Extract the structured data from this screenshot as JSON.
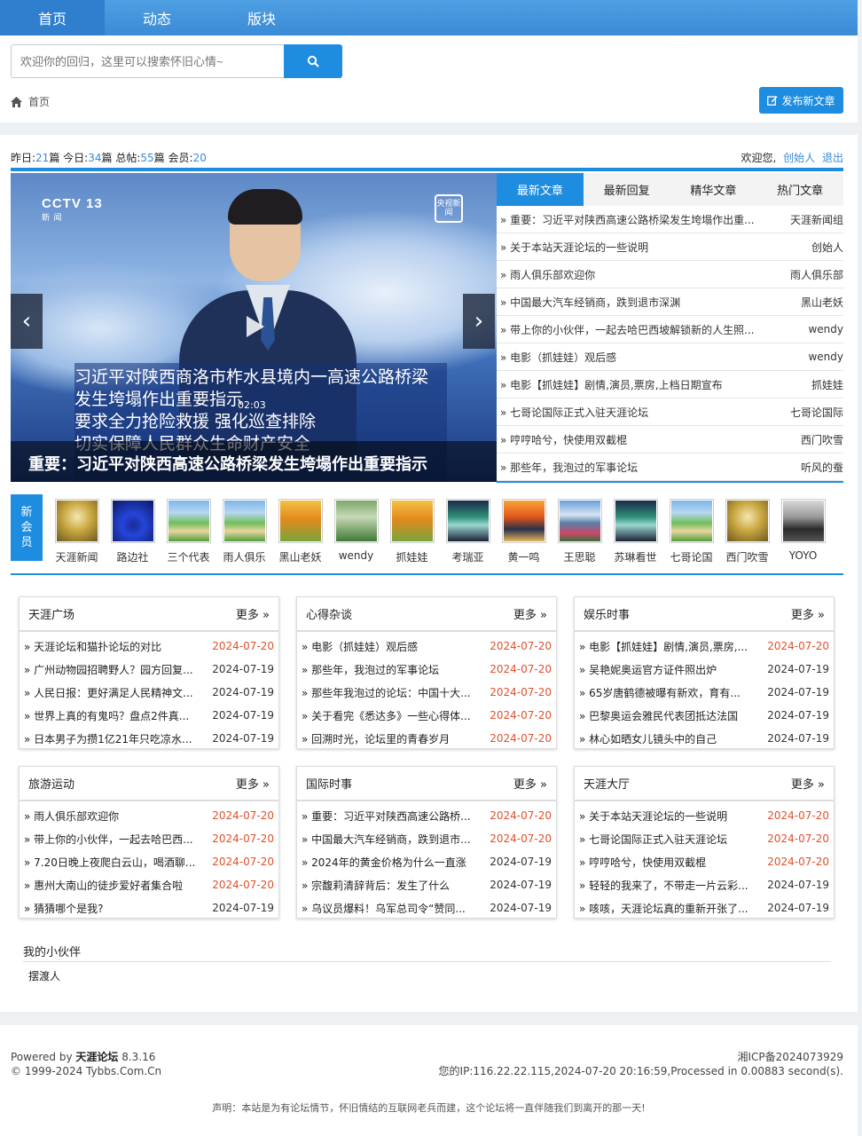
{
  "nav": {
    "items": [
      "首页",
      "动态",
      "版块"
    ]
  },
  "search": {
    "placeholder": "欢迎你的回归，这里可以搜索怀旧心情~"
  },
  "breadcrumb": {
    "home": "首页"
  },
  "publish_button": "发布新文章",
  "stats": {
    "yesterday_label": "昨日:",
    "yesterday": "21",
    "today_label": "今日:",
    "today": "34",
    "total_label": "总帖:",
    "total": "55",
    "members_label": "会员:",
    "members": "20",
    "unit": "篇"
  },
  "welcome": {
    "text": "欢迎您,",
    "user": "创始人",
    "logout": "退出"
  },
  "carousel": {
    "channel": "CCTV 13",
    "channel_sub": "新 闻",
    "badge": "央视新闻",
    "subtitle_lines": [
      "习近平对陕西商洛市柞水县境内一高速公路桥梁",
      "发生垮塌作出重要指示",
      "要求全力抢险救援 强化巡查排除",
      "切实保障人民群众生命财产安全"
    ],
    "timestamp": "02:03",
    "caption": "重要：习近平对陕西高速公路桥梁发生垮塌作出重要指示"
  },
  "tabs": [
    "最新文章",
    "最新回复",
    "精华文章",
    "热门文章"
  ],
  "articles": [
    {
      "title": "重要：习近平对陕西高速公路桥梁发生垮塌作出重...",
      "author": "天涯新闻组"
    },
    {
      "title": "关于本站天涯论坛的一些说明",
      "author": "创始人"
    },
    {
      "title": "雨人俱乐部欢迎你",
      "author": "雨人俱乐部"
    },
    {
      "title": "中国最大汽车经销商，跌到退市深渊",
      "author": "黑山老妖"
    },
    {
      "title": "带上你的小伙伴，一起去哈巴西坡解锁新的人生照...",
      "author": "wendy"
    },
    {
      "title": "电影（抓娃娃）观后感",
      "author": "wendy"
    },
    {
      "title": "电影【抓娃娃】剧情,演员,票房,上档日期宣布",
      "author": "抓娃娃"
    },
    {
      "title": "七哥论国际正式入驻天涯论坛",
      "author": "七哥论国际"
    },
    {
      "title": "哼哼哈兮，快使用双截棍",
      "author": "西门吹雪"
    },
    {
      "title": "那些年，我泡过的军事论坛",
      "author": "听风的蚕"
    }
  ],
  "members_label": [
    "新",
    "会",
    "员"
  ],
  "members": [
    {
      "name": "天涯新闻",
      "avatar": "flower-gold"
    },
    {
      "name": "路边社",
      "avatar": "blue-tree"
    },
    {
      "name": "三个代表",
      "avatar": "path-meadow"
    },
    {
      "name": "雨人俱乐",
      "avatar": "path-meadow"
    },
    {
      "name": "黑山老妖",
      "avatar": "autumn-tree"
    },
    {
      "name": "wendy",
      "avatar": "green-forest"
    },
    {
      "name": "抓娃娃",
      "avatar": "autumn-tree"
    },
    {
      "name": "考瑞亚",
      "avatar": "aurora"
    },
    {
      "name": "黄一鸣",
      "avatar": "cabin-sunset"
    },
    {
      "name": "王思聪",
      "avatar": "lake-mountain"
    },
    {
      "name": "苏琳看世",
      "avatar": "aurora"
    },
    {
      "name": "七哥论国",
      "avatar": "path-meadow"
    },
    {
      "name": "西门吹雪",
      "avatar": "flower-gold"
    },
    {
      "name": "YOYO",
      "avatar": "person-photo"
    }
  ],
  "more_label": "更多 »",
  "boxes": [
    {
      "title": "天涯广场",
      "rows": [
        {
          "t": "天涯论坛和猫扑论坛的对比",
          "d": "2024-07-20",
          "hot": true
        },
        {
          "t": "广州动物园招聘野人？园方回复...",
          "d": "2024-07-19",
          "hot": false
        },
        {
          "t": "人民日报：更好满足人民精神文...",
          "d": "2024-07-19",
          "hot": false
        },
        {
          "t": "世界上真的有鬼吗？盘点2件真...",
          "d": "2024-07-19",
          "hot": false
        },
        {
          "t": "日本男子为攒1亿21年只吃凉水...",
          "d": "2024-07-19",
          "hot": false
        }
      ]
    },
    {
      "title": "心得杂谈",
      "rows": [
        {
          "t": "电影（抓娃娃）观后感",
          "d": "2024-07-20",
          "hot": true
        },
        {
          "t": "那些年，我泡过的军事论坛",
          "d": "2024-07-20",
          "hot": true
        },
        {
          "t": "那些年我泡过的论坛：中国十大...",
          "d": "2024-07-20",
          "hot": true
        },
        {
          "t": "关于看完《悉达多》一些心得体...",
          "d": "2024-07-20",
          "hot": true
        },
        {
          "t": "回溯时光，论坛里的青春岁月",
          "d": "2024-07-20",
          "hot": true
        }
      ]
    },
    {
      "title": "娱乐时事",
      "rows": [
        {
          "t": "电影【抓娃娃】剧情,演员,票房,...",
          "d": "2024-07-20",
          "hot": true
        },
        {
          "t": "吴艳妮奥运官方证件照出炉",
          "d": "2024-07-19",
          "hot": false
        },
        {
          "t": "65岁唐鹤德被曝有新欢，育有...",
          "d": "2024-07-19",
          "hot": false
        },
        {
          "t": "巴黎奥运会雅民代表团抵达法国",
          "d": "2024-07-19",
          "hot": false
        },
        {
          "t": "林心如晒女儿镜头中的自己",
          "d": "2024-07-19",
          "hot": false
        }
      ]
    },
    {
      "title": "旅游运动",
      "rows": [
        {
          "t": "雨人俱乐部欢迎你",
          "d": "2024-07-20",
          "hot": true
        },
        {
          "t": "带上你的小伙伴，一起去哈巴西...",
          "d": "2024-07-20",
          "hot": true
        },
        {
          "t": "7.20日晚上夜爬白云山，喝酒聊...",
          "d": "2024-07-20",
          "hot": true
        },
        {
          "t": "惠州大南山的徒步爱好者集合啦",
          "d": "2024-07-20",
          "hot": true
        },
        {
          "t": "猜猜哪个是我?",
          "d": "2024-07-19",
          "hot": false
        }
      ]
    },
    {
      "title": "国际时事",
      "rows": [
        {
          "t": "重要：习近平对陕西高速公路桥...",
          "d": "2024-07-20",
          "hot": true
        },
        {
          "t": "中国最大汽车经销商，跌到退市...",
          "d": "2024-07-20",
          "hot": true
        },
        {
          "t": "2024年的黄金价格为什么一直涨",
          "d": "2024-07-19",
          "hot": false
        },
        {
          "t": "宗馥莉清辞背后：发生了什么",
          "d": "2024-07-19",
          "hot": false
        },
        {
          "t": "乌议员爆料！乌军总司令“赞同...",
          "d": "2024-07-19",
          "hot": false
        }
      ]
    },
    {
      "title": "天涯大厅",
      "rows": [
        {
          "t": "关于本站天涯论坛的一些说明",
          "d": "2024-07-20",
          "hot": true
        },
        {
          "t": "七哥论国际正式入驻天涯论坛",
          "d": "2024-07-20",
          "hot": true
        },
        {
          "t": "哼哼哈兮，快使用双截棍",
          "d": "2024-07-20",
          "hot": true
        },
        {
          "t": "轻轻的我来了，不带走一片云彩...",
          "d": "2024-07-19",
          "hot": false
        },
        {
          "t": "咳咳，天涯论坛真的重新开张了...",
          "d": "2024-07-19",
          "hot": false
        }
      ]
    }
  ],
  "partners": {
    "title": "我的小伙伴",
    "items": [
      "摆渡人"
    ]
  },
  "footer": {
    "powered_prefix": "Powered by",
    "powered_name": "天涯论坛",
    "version": "8.3.16",
    "copyright": "© 1999-2024 Tybbs.Com.Cn",
    "icp": "湘ICP备2024073929",
    "ip_info": "您的IP:116.22.22.115,2024-07-20 20:16:59,Processed in 0.00883 second(s).",
    "notice": "声明：本站是为有论坛情节，怀旧情结的互联网老兵而建，这个论坛将一直伴随我们到离开的那一天!"
  },
  "colors": {
    "accent": "#1e8de0",
    "hot_date": "#e0502b",
    "nav": "#3a8bd6"
  }
}
